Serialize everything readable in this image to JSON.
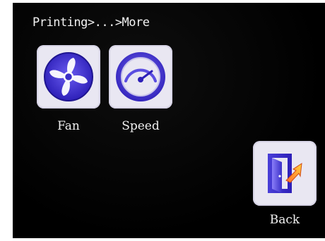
{
  "breadcrumb": "Printing>...>More",
  "items": [
    {
      "label": "Fan",
      "icon": "fan-icon"
    },
    {
      "label": "Speed",
      "icon": "speedometer-icon"
    }
  ],
  "back": {
    "label": "Back",
    "icon": "exit-door-icon"
  },
  "colors": {
    "background": "#000000",
    "tile": "#e9e7f2",
    "accent": "#3a2fc8",
    "text": "#f0f0f0"
  }
}
